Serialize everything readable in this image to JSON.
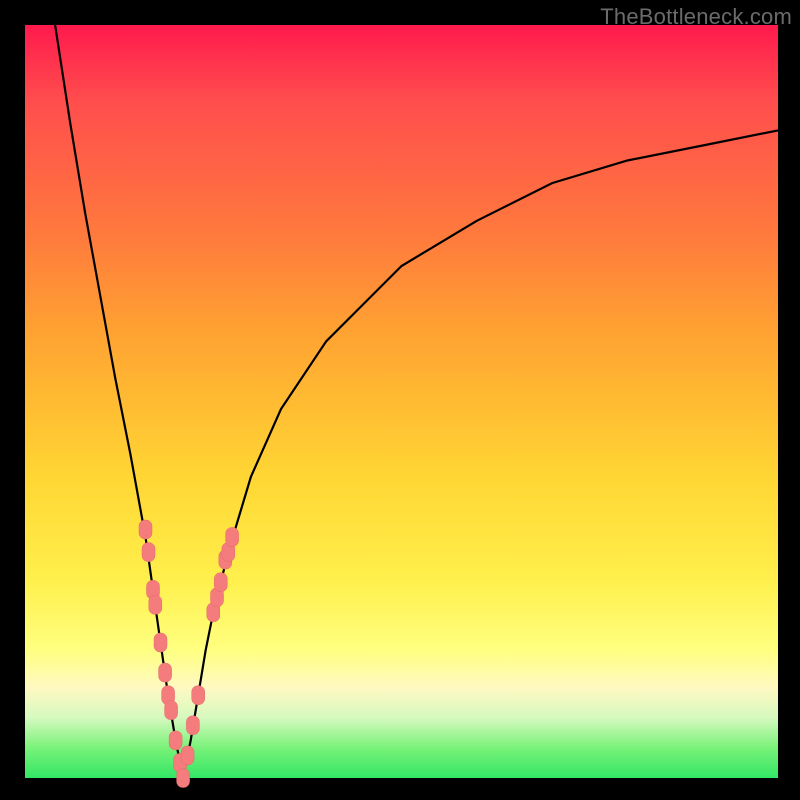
{
  "watermark": "TheBottleneck.com",
  "colors": {
    "curve": "#000000",
    "marker_fill": "#f47c7c",
    "marker_stroke": "#e46a6a",
    "frame": "#000000"
  },
  "chart_data": {
    "type": "line",
    "title": "",
    "xlabel": "",
    "ylabel": "",
    "xlim": [
      0,
      100
    ],
    "ylim": [
      0,
      100
    ],
    "grid": false,
    "legend": false,
    "x_match": 21,
    "series": [
      {
        "name": "bottleneck-curve",
        "x": [
          4,
          6,
          8,
          10,
          12,
          14,
          16,
          17,
          18,
          19,
          20,
          21,
          22,
          23,
          24,
          25,
          27,
          30,
          34,
          40,
          50,
          60,
          70,
          80,
          90,
          100
        ],
        "y": [
          100,
          87,
          75,
          64,
          53,
          43,
          32,
          25,
          18,
          11,
          5,
          0,
          5,
          11,
          17,
          22,
          30,
          40,
          49,
          58,
          68,
          74,
          79,
          82,
          84,
          86
        ]
      }
    ],
    "markers": {
      "name": "product-dots",
      "points": [
        {
          "x": 16.0,
          "y": 33
        },
        {
          "x": 16.4,
          "y": 30
        },
        {
          "x": 17.0,
          "y": 25
        },
        {
          "x": 17.3,
          "y": 23
        },
        {
          "x": 18.0,
          "y": 18
        },
        {
          "x": 18.6,
          "y": 14
        },
        {
          "x": 19.0,
          "y": 11
        },
        {
          "x": 19.4,
          "y": 9
        },
        {
          "x": 20.0,
          "y": 5
        },
        {
          "x": 20.6,
          "y": 2
        },
        {
          "x": 21.0,
          "y": 0
        },
        {
          "x": 21.6,
          "y": 3
        },
        {
          "x": 22.3,
          "y": 7
        },
        {
          "x": 23.0,
          "y": 11
        },
        {
          "x": 25.0,
          "y": 22
        },
        {
          "x": 25.5,
          "y": 24
        },
        {
          "x": 26.0,
          "y": 26
        },
        {
          "x": 26.6,
          "y": 29
        },
        {
          "x": 27.0,
          "y": 30
        },
        {
          "x": 27.5,
          "y": 32
        }
      ]
    }
  }
}
